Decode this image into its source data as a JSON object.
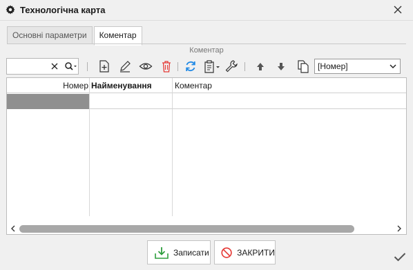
{
  "window": {
    "title": "Технологічна карта",
    "icon": "gear-icon",
    "close_icon": "close-icon"
  },
  "tabs": [
    {
      "label": "Основні параметри",
      "active": false
    },
    {
      "label": "Коментар",
      "active": true
    }
  ],
  "section_caption": "Коментар",
  "toolbar": {
    "search_value": "",
    "icons": [
      "clear-icon",
      "search-icon",
      "add-icon",
      "edit-icon",
      "view-icon",
      "delete-icon",
      "refresh-icon",
      "clipboard-icon",
      "settings-wrench-icon",
      "arrow-up-icon",
      "arrow-down-icon",
      "copy-icon"
    ],
    "sort_select": "[Номер]"
  },
  "grid": {
    "columns": [
      "Номер",
      "Найменування",
      "Коментар"
    ],
    "rows": [
      [
        "",
        "",
        ""
      ]
    ],
    "selected_row": 0
  },
  "buttons": {
    "save_label": "Записати",
    "close_label": "ЗАКРИТИ"
  },
  "colors": {
    "background": "#f0f0f0",
    "refresh": "#1e88e5",
    "delete": "#e53935",
    "save_icon": "#2e9e3e",
    "close_icon": "#e53935",
    "selection": "#8f8f8f"
  }
}
